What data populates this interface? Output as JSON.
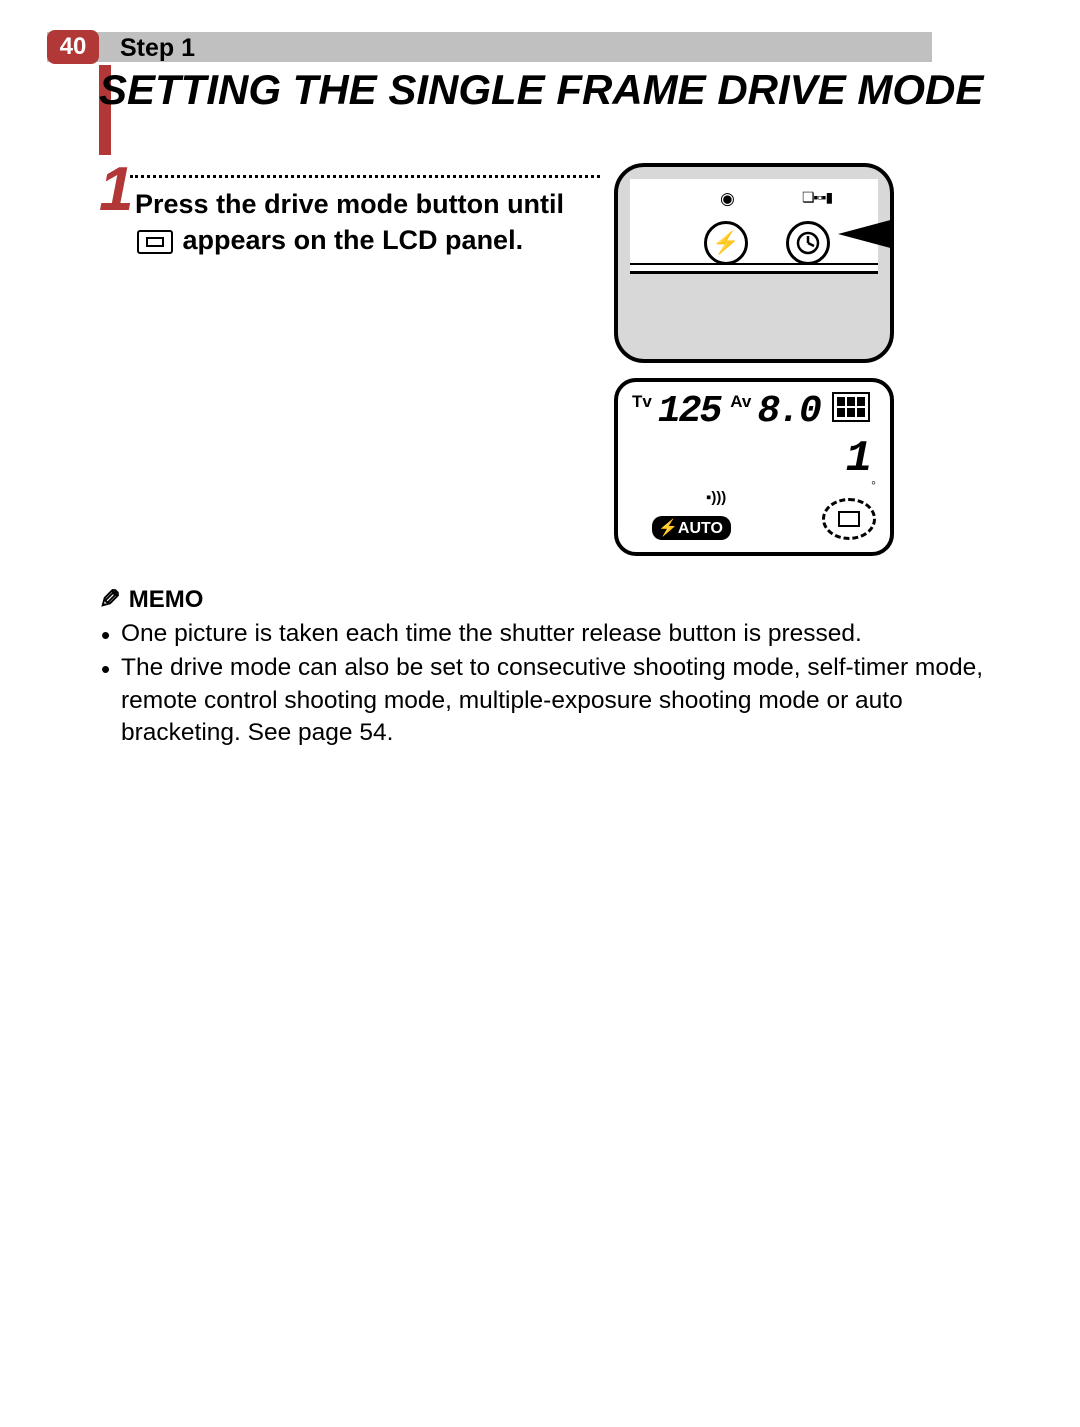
{
  "page_number": "40",
  "step_label": "Step 1",
  "title": "SETTING THE SINGLE FRAME DRIVE MODE",
  "step": {
    "number": "1",
    "text_before": "Press the drive mode button until ",
    "text_after": " appears on the LCD panel."
  },
  "lcd": {
    "tv_label": "Tv",
    "av_label": "Av",
    "tv_value": "125",
    "av_value": "8.0",
    "counter": "1",
    "flash_mode": "⚡AUTO",
    "beep": "▪)))"
  },
  "camera": {
    "top_icons": "❏▪▫▪▮"
  },
  "memo": {
    "header": "MEMO",
    "items": [
      "One picture is taken each time the shutter release button is pressed.",
      "The drive mode can also be set to consecutive shooting mode, self-timer mode, remote control shooting mode, multiple-exposure shooting mode or auto bracketing. See page 54."
    ]
  }
}
